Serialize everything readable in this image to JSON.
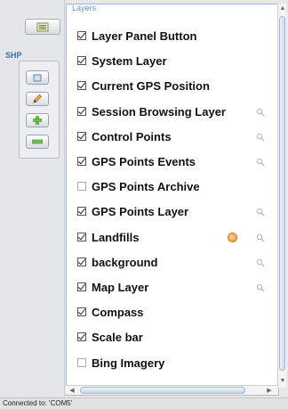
{
  "sidebar": {
    "layers_toggle_icon": "layers-list-icon",
    "section_label": "SHP",
    "tools": [
      {
        "icon": "select-rectangle-icon"
      },
      {
        "icon": "pencil-icon"
      },
      {
        "icon": "plus-icon"
      },
      {
        "icon": "minus-icon"
      }
    ]
  },
  "panel": {
    "title": "Layers",
    "layers": [
      {
        "label": "Layer Panel Button",
        "checked": true,
        "zoom": false,
        "legend": false
      },
      {
        "label": "System Layer",
        "checked": true,
        "zoom": false,
        "legend": false
      },
      {
        "label": "Current GPS Position",
        "checked": true,
        "zoom": false,
        "legend": false
      },
      {
        "label": "Session Browsing Layer",
        "checked": true,
        "zoom": true,
        "legend": false
      },
      {
        "label": "Control Points",
        "checked": true,
        "zoom": true,
        "legend": false
      },
      {
        "label": "GPS Points Events",
        "checked": true,
        "zoom": true,
        "legend": false
      },
      {
        "label": "GPS Points Archive",
        "checked": false,
        "zoom": false,
        "legend": false
      },
      {
        "label": "GPS Points Layer",
        "checked": true,
        "zoom": true,
        "legend": false
      },
      {
        "label": "Landfills",
        "checked": true,
        "zoom": true,
        "legend": true
      },
      {
        "label": "background",
        "checked": true,
        "zoom": true,
        "legend": false
      },
      {
        "label": "Map Layer",
        "checked": true,
        "zoom": true,
        "legend": false
      },
      {
        "label": "Compass",
        "checked": true,
        "zoom": false,
        "legend": false
      },
      {
        "label": "Scale bar",
        "checked": true,
        "zoom": false,
        "legend": false
      },
      {
        "label": "Bing Imagery",
        "checked": false,
        "zoom": false,
        "legend": false
      }
    ]
  },
  "status": {
    "text": "Connected to: 'COM5'"
  },
  "colors": {
    "accent": "#6a96c8",
    "panel_border": "#9eb8d8",
    "legend_orange": "#f0902e"
  }
}
